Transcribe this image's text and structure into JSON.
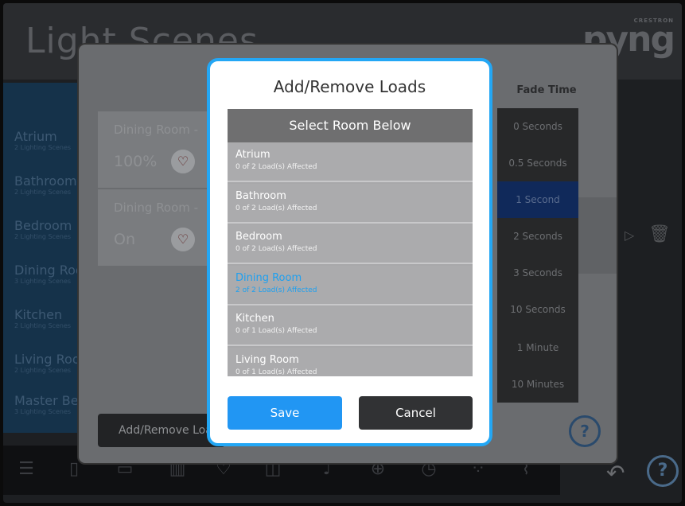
{
  "app": {
    "title": "Light Scenes",
    "brand_small": "CRESTRON",
    "brand_large": "pyng"
  },
  "background_rooms": [
    {
      "name": "Atrium",
      "sub": "2 Lighting Scenes"
    },
    {
      "name": "Bathroom",
      "sub": "2 Lighting Scenes"
    },
    {
      "name": "Bedroom",
      "sub": "2 Lighting Scenes"
    },
    {
      "name": "Dining Room",
      "sub": "3 Lighting Scenes"
    },
    {
      "name": "Kitchen",
      "sub": "2 Lighting Scenes"
    },
    {
      "name": "Living Room",
      "sub": "2 Lighting Scenes"
    },
    {
      "name": "Master Bedroom",
      "sub": "3 Lighting Scenes"
    }
  ],
  "load_cards": [
    {
      "title": "Dining Room -",
      "value": "100%"
    },
    {
      "title": "Dining Room -",
      "value": "On"
    }
  ],
  "panel": {
    "add_remove_label": "Add/Remove Loads",
    "fade_header": "Fade Time",
    "fade_options": [
      "0 Seconds",
      "0.5 Seconds",
      "1 Second",
      "2 Seconds",
      "3 Seconds",
      "10 Seconds",
      "1 Minute",
      "10 Minutes"
    ],
    "fade_selected": "1 Second",
    "help": "?"
  },
  "modal": {
    "title": "Add/Remove Loads",
    "list_header": "Select Room Below",
    "rooms": [
      {
        "name": "Atrium",
        "sub": "0 of 2 Load(s) Affected",
        "active": false
      },
      {
        "name": "Bathroom",
        "sub": "0 of 2 Load(s) Affected",
        "active": false
      },
      {
        "name": "Bedroom",
        "sub": "0 of 2 Load(s) Affected",
        "active": false
      },
      {
        "name": "Dining Room",
        "sub": "2 of 2 Load(s) Affected",
        "active": true
      },
      {
        "name": "Kitchen",
        "sub": "0 of 1 Load(s) Affected",
        "active": false
      },
      {
        "name": "Living Room",
        "sub": "0 of 1 Load(s) Affected",
        "active": false
      }
    ],
    "save_label": "Save",
    "cancel_label": "Cancel"
  },
  "footer": {
    "help": "?"
  },
  "colors": {
    "accent": "#23a7f5",
    "save": "#2196f3",
    "cancel": "#313234",
    "active_room_text": "#1ea0f0"
  }
}
